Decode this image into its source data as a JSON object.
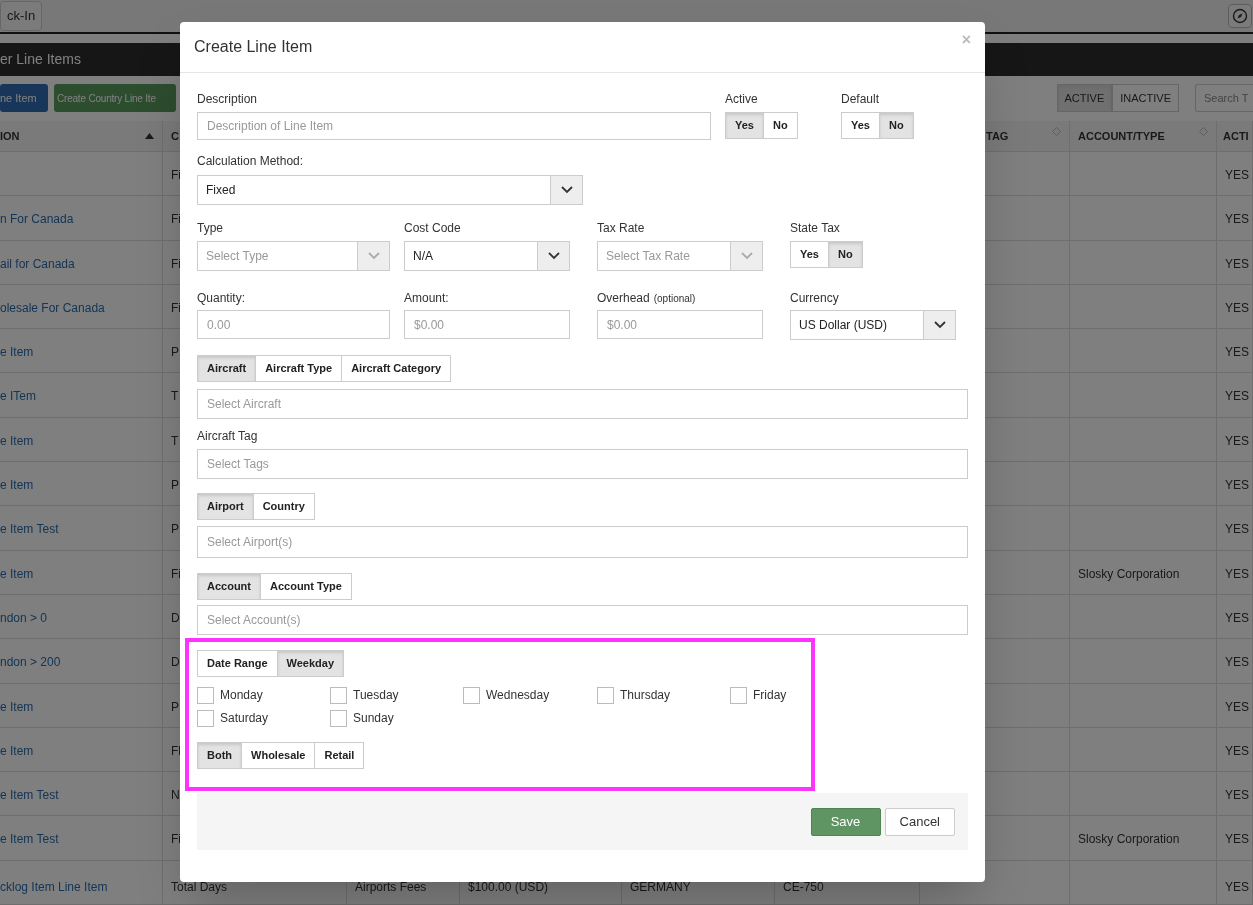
{
  "background": {
    "top_bar": {
      "button": "ck-In"
    },
    "section_title": "er Line Items",
    "toolbar": {
      "buttons": [
        {
          "label": "ne Item",
          "kind": "primary"
        },
        {
          "label": "Create Country Line Ite",
          "kind": "success"
        }
      ],
      "status_toggle": [
        {
          "label": "ACTIVE",
          "selected": true
        },
        {
          "label": "INACTIVE",
          "selected": false
        }
      ],
      "search": {
        "placeholder": "Search T"
      }
    },
    "table": {
      "columns": [
        {
          "header": "ION",
          "sorted": true
        },
        {
          "header": "C"
        },
        {},
        {},
        {},
        {},
        {
          "header": "TAG",
          "sorted": false
        },
        {
          "header": "ACCOUNT/TYPE",
          "sorted": false
        },
        {
          "header": "ACTI"
        }
      ],
      "rows": [
        [
          null,
          "Fi",
          null,
          null,
          null,
          null,
          null,
          null,
          "YES"
        ],
        [
          "n For Canada",
          "Fi",
          null,
          null,
          null,
          null,
          null,
          null,
          "YES"
        ],
        [
          "ail for Canada",
          "Fi",
          null,
          null,
          null,
          null,
          null,
          null,
          "YES"
        ],
        [
          "olesale For Canada",
          "Fi",
          null,
          null,
          null,
          null,
          null,
          null,
          "YES"
        ],
        [
          "e Item",
          "P",
          null,
          null,
          null,
          null,
          null,
          null,
          "YES"
        ],
        [
          "e ITem",
          "T",
          null,
          null,
          null,
          null,
          null,
          null,
          "YES"
        ],
        [
          "e Item",
          "T",
          null,
          null,
          null,
          null,
          null,
          null,
          "YES"
        ],
        [
          "e Item",
          "P",
          null,
          null,
          null,
          null,
          null,
          null,
          "YES"
        ],
        [
          "e Item Test",
          "P",
          null,
          null,
          null,
          null,
          null,
          null,
          "YES"
        ],
        [
          "e Item",
          "Fi",
          null,
          null,
          null,
          null,
          null,
          "Slosky Corporation",
          "YES"
        ],
        [
          "ndon > 0",
          "D",
          null,
          null,
          null,
          null,
          null,
          null,
          "YES"
        ],
        [
          "ndon > 200",
          "D",
          null,
          null,
          null,
          null,
          null,
          null,
          "YES"
        ],
        [
          "e Item",
          "P",
          null,
          null,
          null,
          null,
          null,
          null,
          "YES"
        ],
        [
          "e Item",
          "Fl",
          null,
          null,
          null,
          null,
          null,
          null,
          "YES"
        ],
        [
          "e Item Test",
          "N",
          null,
          null,
          null,
          null,
          null,
          null,
          "YES"
        ],
        [
          "e Item Test",
          "Fi",
          null,
          null,
          null,
          null,
          null,
          "Slosky Corporation",
          "YES"
        ],
        [
          "cklog Item Line Item",
          "Total Days",
          "Airports Fees",
          "$100.00 (USD)",
          "GERMANY",
          "CE-750",
          null,
          null,
          "YES"
        ]
      ]
    }
  },
  "modal": {
    "title": "Create Line Item",
    "close": "×",
    "description": {
      "label": "Description",
      "placeholder": "Description of Line Item"
    },
    "active": {
      "label": "Active",
      "options": [
        {
          "label": "Yes",
          "selected": true
        },
        {
          "label": "No",
          "selected": false
        }
      ]
    },
    "default": {
      "label": "Default",
      "options": [
        {
          "label": "Yes",
          "selected": false
        },
        {
          "label": "No",
          "selected": true
        }
      ]
    },
    "calculation_method": {
      "label": "Calculation Method:",
      "value": "Fixed"
    },
    "type": {
      "label": "Type",
      "placeholder": "Select Type",
      "disabled": true
    },
    "cost_code": {
      "label": "Cost Code",
      "value": "N/A",
      "disabled": false
    },
    "tax_rate": {
      "label": "Tax Rate",
      "placeholder": "Select Tax Rate",
      "disabled": true
    },
    "state_tax": {
      "label": "State Tax",
      "options": [
        {
          "label": "Yes",
          "selected": false
        },
        {
          "label": "No",
          "selected": true
        }
      ]
    },
    "quantity": {
      "label": "Quantity:",
      "placeholder": "0.00"
    },
    "amount": {
      "label": "Amount:",
      "placeholder": "$0.00"
    },
    "overhead": {
      "label": "Overhead",
      "hint": "(optional)",
      "placeholder": "$0.00"
    },
    "currency": {
      "label": "Currency",
      "value": "US Dollar (USD)"
    },
    "aircraft_tabs": [
      {
        "label": "Aircraft",
        "selected": true
      },
      {
        "label": "Aircraft Type",
        "selected": false
      },
      {
        "label": "Aircraft Category",
        "selected": false
      }
    ],
    "aircraft": {
      "placeholder": "Select Aircraft"
    },
    "aircraft_tag": {
      "label": "Aircraft Tag",
      "placeholder": "Select Tags"
    },
    "location_tabs": [
      {
        "label": "Airport",
        "selected": true
      },
      {
        "label": "Country",
        "selected": false
      }
    ],
    "airport": {
      "placeholder": "Select Airport(s)"
    },
    "account_tabs": [
      {
        "label": "Account",
        "selected": true
      },
      {
        "label": "Account Type",
        "selected": false
      }
    ],
    "account": {
      "placeholder": "Select Account(s)"
    },
    "date_tabs": [
      {
        "label": "Date Range",
        "selected": false
      },
      {
        "label": "Weekday",
        "selected": true
      }
    ],
    "weekdays": [
      {
        "label": "Monday",
        "checked": false
      },
      {
        "label": "Tuesday",
        "checked": false
      },
      {
        "label": "Wednesday",
        "checked": false
      },
      {
        "label": "Thursday",
        "checked": false
      },
      {
        "label": "Friday",
        "checked": false
      },
      {
        "label": "Saturday",
        "checked": false
      },
      {
        "label": "Sunday",
        "checked": false
      }
    ],
    "sale_tabs": [
      {
        "label": "Both",
        "selected": true
      },
      {
        "label": "Wholesale",
        "selected": false
      },
      {
        "label": "Retail",
        "selected": false
      }
    ],
    "highlighted": true,
    "buttons": [
      {
        "label": "Save",
        "kind": "primary"
      },
      {
        "label": "Cancel",
        "kind": "default"
      }
    ]
  }
}
